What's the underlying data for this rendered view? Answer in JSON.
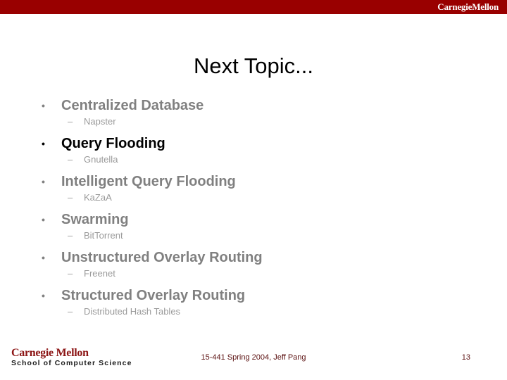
{
  "header": {
    "logo_text": "CarnegieMellon",
    "band_color": "#990000"
  },
  "slide": {
    "title": "Next Topic...",
    "title_color": "#000000"
  },
  "content": {
    "active_color": "#000000",
    "dim_color": "#808080",
    "sub_color": "#9a9a9a",
    "bullet_marker": "•",
    "sub_marker": "–",
    "groups": [
      {
        "title": "Centralized Database",
        "sub": "Napster",
        "state": "dim"
      },
      {
        "title": "Query Flooding",
        "sub": "Gnutella",
        "state": "active"
      },
      {
        "title": "Intelligent Query Flooding",
        "sub": "KaZaA",
        "state": "dim"
      },
      {
        "title": "Swarming",
        "sub": "BitTorrent",
        "state": "dim"
      },
      {
        "title": "Unstructured Overlay Routing",
        "sub": "Freenet",
        "state": "dim"
      },
      {
        "title": "Structured Overlay Routing",
        "sub": "Distributed Hash Tables",
        "state": "dim"
      }
    ]
  },
  "footer": {
    "logo_line1": "Carnegie Mellon",
    "logo_line2": "School of Computer Science",
    "center_text": "15-441 Spring 2004, Jeff Pang",
    "page_number": "13",
    "text_color": "#5c1212"
  }
}
